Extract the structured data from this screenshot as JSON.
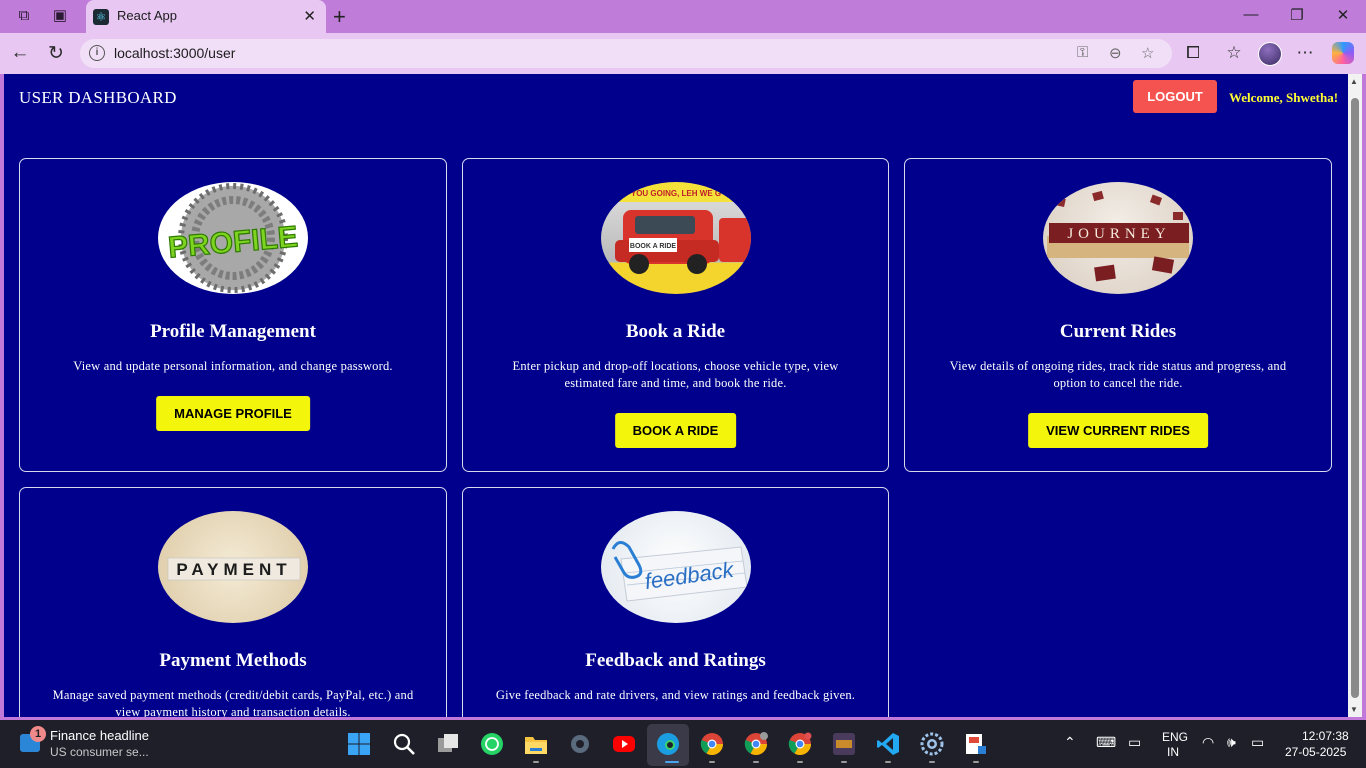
{
  "browser": {
    "tab_title": "React App",
    "url": "localhost:3000/user"
  },
  "header": {
    "title": "USER DASHBOARD",
    "logout_label": "LOGOUT",
    "welcome_text": "Welcome, Shwetha!"
  },
  "cards": [
    {
      "title": "Profile Management",
      "description": "View and update personal information, and change password.",
      "button": "MANAGE PROFILE",
      "image_text": "PROFILE"
    },
    {
      "title": "Book a Ride",
      "description": "Enter pickup and drop-off locations, choose vehicle type, view estimated fare and time, and book the ride.",
      "button": "BOOK A RIDE",
      "image_text": "BOOK A RIDE",
      "image_banner": "YOU GOING, LEH WE G"
    },
    {
      "title": "Current Rides",
      "description": "View details of ongoing rides, track ride status and progress, and option to cancel the ride.",
      "button": "VIEW CURRENT RIDES",
      "image_text": "JOURNEY"
    },
    {
      "title": "Payment Methods",
      "description": "Manage saved payment methods (credit/debit cards, PayPal, etc.) and view payment history and transaction details.",
      "image_text": "PAYMENT"
    },
    {
      "title": "Feedback and Ratings",
      "description": "Give feedback and rate drivers, and view ratings and feedback given.",
      "image_text": "feedback"
    }
  ],
  "taskbar": {
    "news_badge": "1",
    "news_title": "Finance headline",
    "news_sub": "US consumer se...",
    "lang_1": "ENG",
    "lang_2": "IN",
    "time": "12:07:38",
    "date": "27-05-2025"
  },
  "colors": {
    "page_bg": "#00008c",
    "accent_button": "#f3f50b",
    "logout_button": "#f5534f",
    "welcome_text": "#ffff33"
  }
}
